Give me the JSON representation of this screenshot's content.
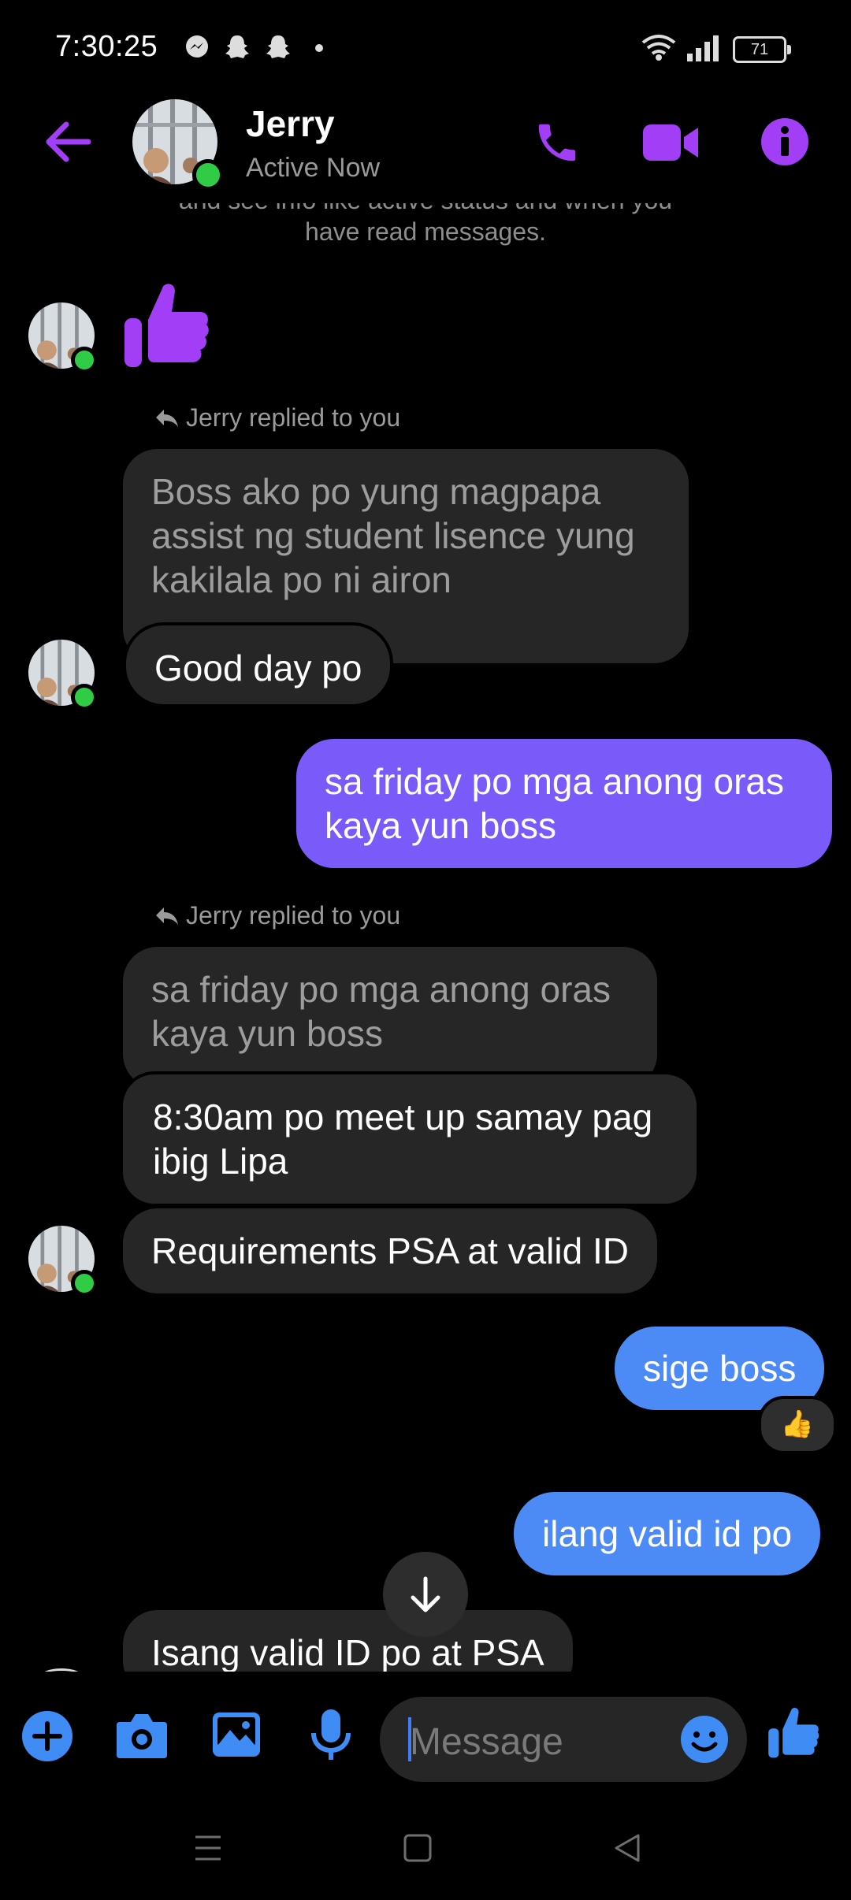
{
  "status_bar": {
    "time": "7:30:25",
    "battery": "71"
  },
  "header": {
    "name": "Jerry",
    "status": "Active Now"
  },
  "notice": {
    "line_partial": "and see info like active status and when you",
    "line2": "have read messages."
  },
  "accent_colors": {
    "purple": "#7a5af8",
    "blue": "#4c8bf5",
    "online": "#31cc46"
  },
  "messages": {
    "reply_label_1": "Jerry replied to you",
    "quote_1": [
      "Boss ako po yung magpapa",
      "assist ng student lisence yung",
      "kakilala po ni airon"
    ],
    "msg_good_day": "Good day po",
    "my_msg_1": [
      "sa friday po mga anong oras",
      "kaya yun boss"
    ],
    "reply_label_2": "Jerry replied to you",
    "quote_2": [
      "sa friday po mga anong oras",
      "kaya yun boss"
    ],
    "msg_meetup": [
      "8:30am po meet up samay pag",
      "ibig Lipa"
    ],
    "msg_requirements": "Requirements PSA at valid ID",
    "my_msg_2": "sige boss",
    "reaction": "👍",
    "my_msg_3": "ilang valid id po",
    "msg_last": "Isang valid ID po at PSA"
  },
  "composer": {
    "placeholder": "Message"
  },
  "icons": [
    "back-arrow-icon",
    "phone-icon",
    "video-icon",
    "info-icon",
    "plus-icon",
    "camera-icon",
    "image-icon",
    "mic-icon",
    "emoji-icon",
    "thumbs-up-icon",
    "menu-nav-icon",
    "home-nav-icon",
    "back-nav-icon",
    "arrow-down-icon",
    "reply-icon"
  ]
}
